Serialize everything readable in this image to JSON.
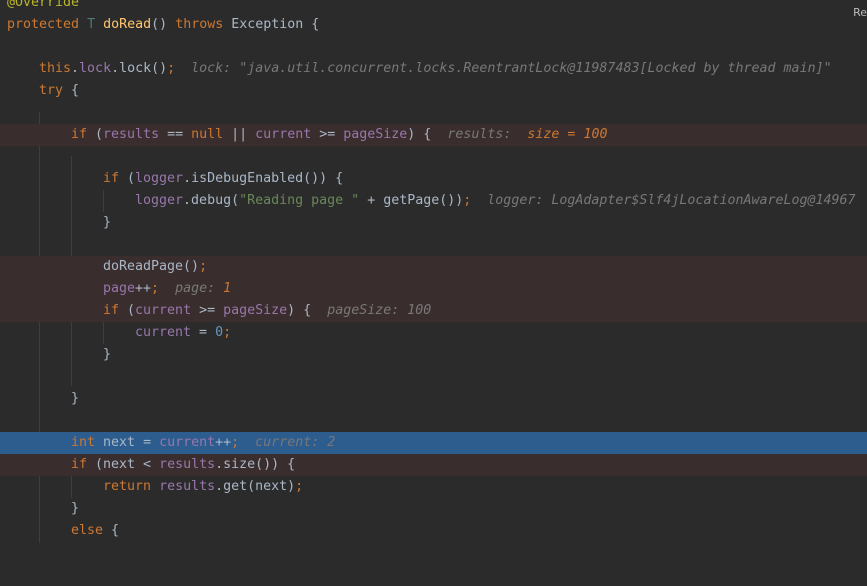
{
  "corner_label": "Re",
  "lines": {
    "l0": {
      "ann": "@Override"
    },
    "l1": {
      "kw1": "protected",
      "type": "T",
      "name": "doRead",
      "rest1": "() ",
      "kw2": "throws",
      "rest2": " Exception {"
    },
    "l3": {
      "kw": "this",
      "dot1": ".",
      "fld": "lock",
      "rest": ".lock()",
      "semi": ";",
      "hint": "lock: \"java.util.concurrent.locks.ReentrantLock@11987483[Locked by thread main]\""
    },
    "l4": {
      "kw": "try",
      "rest": " {"
    },
    "l6": {
      "kw": "if",
      "p1": " (",
      "f1": "results",
      "op1": " == ",
      "kw2": "null",
      "op2": " || ",
      "f2": "current",
      "op3": " >= ",
      "f3": "pageSize",
      "p2": ") {",
      "hint1": "results:",
      "hint2": "size = 100"
    },
    "l8": {
      "kw": "if",
      "p1": " (",
      "f1": "logger",
      "rest": ".isDebugEnabled()) {"
    },
    "l9": {
      "f1": "logger",
      "rest1": ".debug(",
      "str": "\"Reading page \"",
      "rest2": " + getPage())",
      "semi": ";",
      "hint": "logger: LogAdapter$Slf4jLocationAwareLog@14967"
    },
    "l10": {
      "rest": "}"
    },
    "l12": {
      "rest": "doReadPage()",
      "semi": ";"
    },
    "l13": {
      "f1": "page",
      "rest": "++",
      "semi": ";",
      "hint1": "page:",
      "hint2": "1"
    },
    "l14": {
      "kw": "if",
      "p1": " (",
      "f1": "current",
      "op": " >= ",
      "f2": "pageSize",
      "p2": ") {",
      "hint": "pageSize: 100"
    },
    "l15": {
      "f1": "current",
      "op": " = ",
      "num": "0",
      "semi": ";"
    },
    "l16": {
      "rest": "}"
    },
    "l18": {
      "rest": "}"
    },
    "l20": {
      "kw": "int",
      "rest1": " next = ",
      "f1": "current",
      "rest2": "++",
      "semi": ";",
      "hint": "current: 2"
    },
    "l21": {
      "kw": "if",
      "rest1": " (next < ",
      "f1": "results",
      "rest2": ".size()) {"
    },
    "l22": {
      "kw": "return",
      "sp": " ",
      "f1": "results",
      "rest": ".get(next)",
      "semi": ";"
    },
    "l23": {
      "rest": "}"
    },
    "l24": {
      "kw": "else",
      "rest": " {"
    }
  }
}
